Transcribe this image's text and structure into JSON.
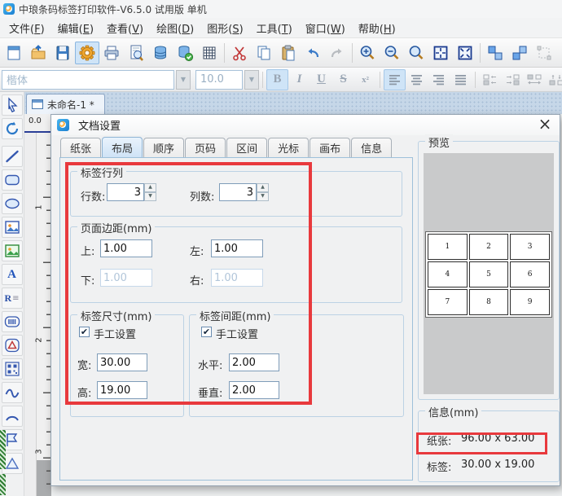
{
  "window": {
    "title": "中琅条码标签打印软件-V6.5.0 试用版 单机"
  },
  "menu": {
    "items": [
      {
        "pre": "文件(",
        "key": "F",
        "post": ")"
      },
      {
        "pre": "编辑(",
        "key": "E",
        "post": ")"
      },
      {
        "pre": "查看(",
        "key": "V",
        "post": ")"
      },
      {
        "pre": "绘图(",
        "key": "D",
        "post": ")"
      },
      {
        "pre": "图形(",
        "key": "S",
        "post": ")"
      },
      {
        "pre": "工具(",
        "key": "T",
        "post": ")"
      },
      {
        "pre": "窗口(",
        "key": "W",
        "post": ")"
      },
      {
        "pre": "帮助(",
        "key": "H",
        "post": ")"
      }
    ]
  },
  "toolbar": {
    "icon_names": [
      "new-document",
      "open",
      "save",
      "document-setup",
      "print",
      "print-preview",
      "database",
      "database-connected",
      "grid-setup",
      "cut",
      "copy",
      "paste",
      "undo",
      "redo",
      "zoom-in",
      "zoom-out",
      "zoom",
      "fit-page",
      "fit-selection",
      "group",
      "group-2",
      "ungroup"
    ]
  },
  "format_bar": {
    "font_name": "楷体",
    "font_size": "10.0",
    "bold": "B",
    "italic": "I",
    "underline": "U",
    "strike": "S",
    "script": "x²",
    "icon_names": [
      "align-left",
      "align-center",
      "align-right",
      "align-justify",
      "distribute-left",
      "distribute-right",
      "equal-width",
      "equal-height"
    ]
  },
  "document_tab": {
    "label": "未命名-1 *"
  },
  "ruler": {
    "origin": "0.0",
    "v_numbers": [
      "1",
      "2",
      "3"
    ]
  },
  "glyphs": {
    "dropdown": "▼",
    "spin_up": "▲",
    "spin_down": "▼",
    "check": "✔",
    "close": "×",
    "text_tool": "A",
    "richtext_tool": "R",
    "richtext_lines": "≡"
  },
  "dialog": {
    "title": "文档设置",
    "tabs": [
      {
        "label": "纸张"
      },
      {
        "label": "布局"
      },
      {
        "label": "顺序"
      },
      {
        "label": "页码"
      },
      {
        "label": "区间"
      },
      {
        "label": "光标"
      },
      {
        "label": "画布"
      },
      {
        "label": "信息"
      }
    ],
    "selected_tab": "布局",
    "rows_cols": {
      "title": "标签行列",
      "rows_label": "行数:",
      "rows_value": "3",
      "cols_label": "列数:",
      "cols_value": "3"
    },
    "margins": {
      "title": "页面边距(mm)",
      "top_label": "上:",
      "top_value": "1.00",
      "left_label": "左:",
      "left_value": "1.00",
      "bottom_label": "下:",
      "bottom_value": "1.00",
      "right_label": "右:",
      "right_value": "1.00"
    },
    "label_size": {
      "title": "标签尺寸(mm)",
      "manual_label": "手工设置",
      "manual_checked": true,
      "width_label": "宽:",
      "width_value": "30.00",
      "height_label": "高:",
      "height_value": "19.00"
    },
    "label_gap": {
      "title": "标签间距(mm)",
      "manual_label": "手工设置",
      "manual_checked": true,
      "h_label": "水平:",
      "h_value": "2.00",
      "v_label": "垂直:",
      "v_value": "2.00"
    },
    "preview": {
      "title": "预览",
      "cells": [
        "1",
        "2",
        "3",
        "4",
        "5",
        "6",
        "7",
        "8",
        "9"
      ]
    },
    "info": {
      "title": "信息(mm)",
      "paper_label": "纸张:",
      "paper_value": "96.00 x 63.00",
      "label_label": "标签:",
      "label_value": "30.00 x 19.00"
    }
  },
  "colors": {
    "annotation": "#e8393d",
    "tab_selected_bg": "#d8e9f8",
    "preview_bg": "#c9cacb",
    "highlight_bg": "#cfe4f7"
  }
}
